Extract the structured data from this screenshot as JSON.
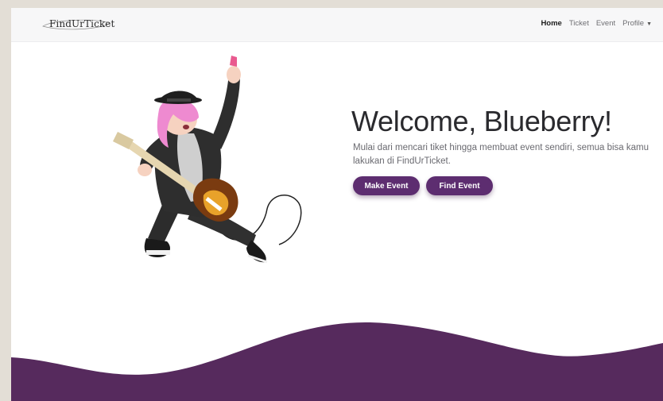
{
  "navbar": {
    "brand": "FindUrTicket",
    "links": {
      "home": "Home",
      "ticket": "Ticket",
      "event": "Event",
      "profile": "Profile"
    }
  },
  "hero": {
    "title": "Welcome, Blueberry!",
    "subtitle": "Mulai dari mencari tiket hingga membuat event sendiri, semua bisa kamu lakukan di FindUrTicket.",
    "buttons": {
      "make_event": "Make Event",
      "find_event": "Find Event"
    },
    "illustration": "guitarist-illustration"
  },
  "colors": {
    "accent": "#5d2d70",
    "wave": "#562a5d",
    "navbar_bg": "#f7f7f8",
    "outer_bg": "#e3ded6"
  }
}
